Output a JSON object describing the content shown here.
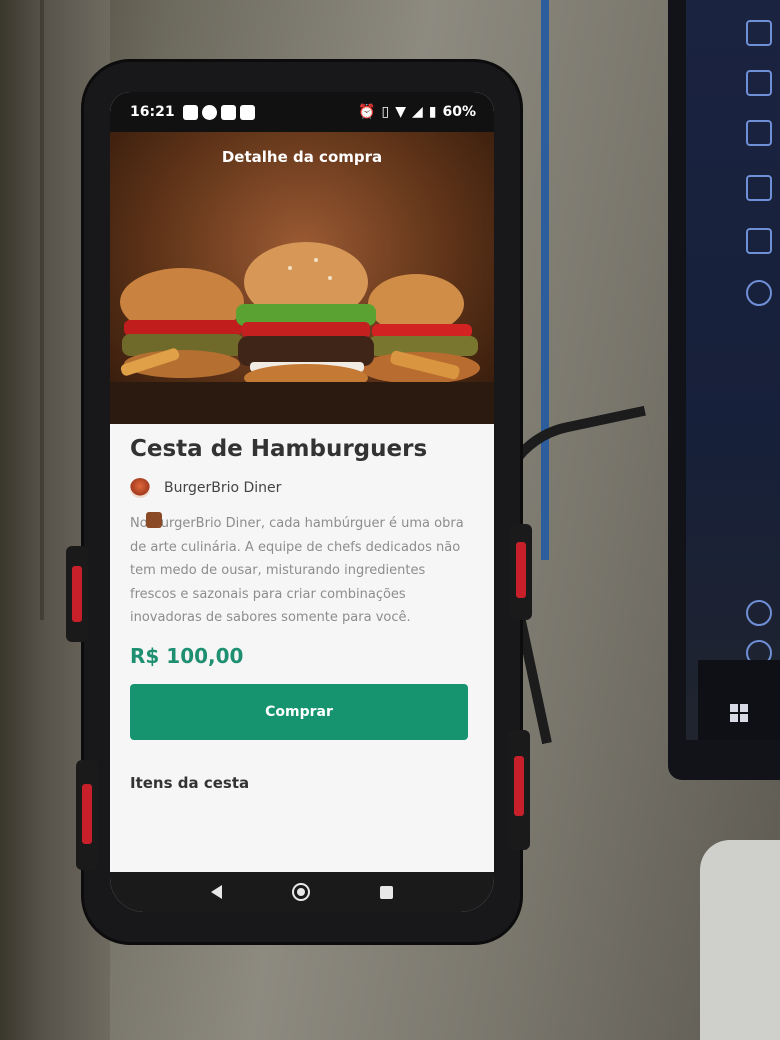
{
  "status_bar": {
    "time": "16:21",
    "battery": "60%",
    "left_icons": [
      "youtube-icon",
      "assistant-icon",
      "mail-icon",
      "s-app-icon"
    ],
    "right_icons": [
      "alarm-icon",
      "vibrate-icon",
      "wifi-icon",
      "signal-icon",
      "battery-icon"
    ]
  },
  "header": {
    "title": "Detalhe da compra"
  },
  "product": {
    "name": "Cesta de Hamburguers",
    "store_name": "BurgerBrio Diner",
    "description": "No BurgerBrio Diner, cada hambúrguer é uma obra de arte culinária. A equipe de chefs dedicados não tem medo de ousar, misturando ingredientes frescos e sazonais para criar combinações inovadoras de sabores somente para você.",
    "price": "R$ 100,00",
    "buy_label": "Comprar"
  },
  "basket": {
    "items_title": "Itens da cesta"
  },
  "colors": {
    "accent": "#15946f",
    "price": "#1e8f70"
  }
}
